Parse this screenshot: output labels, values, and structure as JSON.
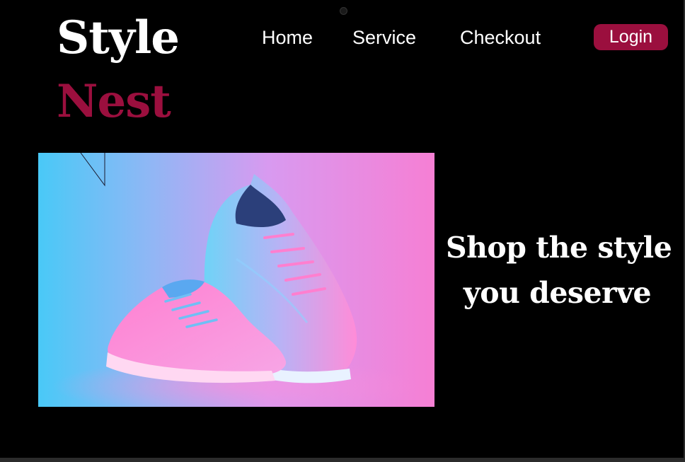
{
  "brand": {
    "line1": "Style",
    "line2": "Nest",
    "accent_color": "#9b0f3e"
  },
  "nav": {
    "items": [
      {
        "label": "Home"
      },
      {
        "label": "Service"
      },
      {
        "label": "Checkout"
      }
    ],
    "login_label": "Login"
  },
  "hero": {
    "image_subject": "pink and blue sneakers",
    "tagline_line1": "Shop the style",
    "tagline_line2": "you deserve"
  },
  "colors": {
    "background": "#000000",
    "text": "#ffffff",
    "gradient_left": "#49c9f7",
    "gradient_right": "#f67fd4"
  }
}
